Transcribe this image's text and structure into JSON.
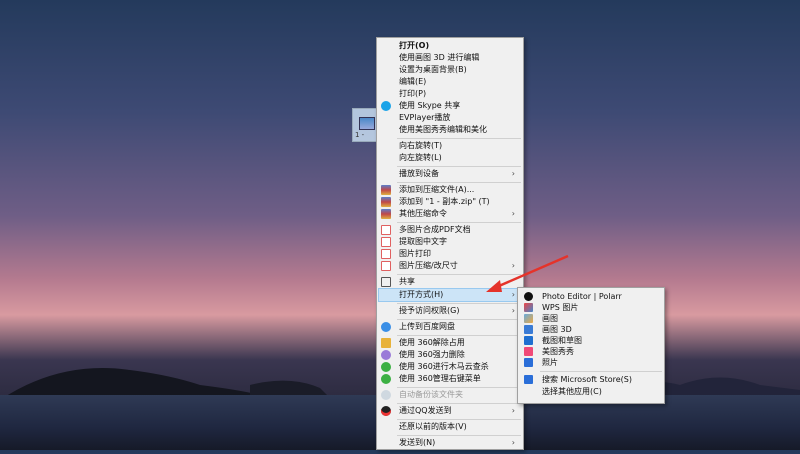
{
  "desktop": {
    "icon_label": "1 -"
  },
  "context_menu": {
    "items": [
      {
        "label": "打开(O)",
        "bold": true
      },
      {
        "label": "使用画图 3D 进行编辑"
      },
      {
        "label": "设置为桌面背景(B)"
      },
      {
        "label": "编辑(E)"
      },
      {
        "label": "打印(P)"
      },
      {
        "label": "使用 Skype 共享",
        "icon": "skype-icon"
      },
      {
        "label": "EVPlayer播放"
      },
      {
        "label": "使用美图秀秀编辑和美化"
      },
      {
        "label": "向右旋转(T)"
      },
      {
        "label": "向左旋转(L)"
      },
      {
        "label": "播放到设备",
        "submenu": true
      },
      {
        "label": "添加到压缩文件(A)...",
        "icon": "archive-icon"
      },
      {
        "label": "添加到 \"1 - 副本.zip\" (T)",
        "icon": "archive-icon"
      },
      {
        "label": "其他压缩命令",
        "icon": "archive-icon",
        "submenu": true
      },
      {
        "label": "多图片合成PDF文档",
        "icon": "pdf-icon"
      },
      {
        "label": "提取图中文字",
        "icon": "text-extract-icon"
      },
      {
        "label": "图片打印",
        "icon": "print-icon"
      },
      {
        "label": "图片压缩/改尺寸",
        "icon": "compress-icon",
        "submenu": true
      },
      {
        "label": "共享",
        "icon": "share-icon"
      },
      {
        "label": "打开方式(H)",
        "submenu": true,
        "highlighted": true
      },
      {
        "label": "授予访问权限(G)",
        "submenu": true
      },
      {
        "label": "上传到百度网盘",
        "icon": "baidu-cloud-icon"
      },
      {
        "label": "使用 360解除占用",
        "icon": "folder-360-icon"
      },
      {
        "label": "使用 360强力删除",
        "icon": "delete-360-icon"
      },
      {
        "label": "使用 360进行木马云查杀",
        "icon": "shield-360-icon"
      },
      {
        "label": "使用 360管理右键菜单",
        "icon": "menu-360-icon"
      },
      {
        "label": "自动备份该文件夹",
        "icon": "backup-icon",
        "disabled": true
      },
      {
        "label": "通过QQ发送到",
        "icon": "qq-icon",
        "submenu": true
      },
      {
        "label": "还原以前的版本(V)"
      },
      {
        "label": "发送到(N)",
        "submenu": true
      }
    ]
  },
  "open_with_menu": {
    "items": [
      {
        "label": "Photo Editor | Polarr",
        "icon": "polarr-icon"
      },
      {
        "label": "WPS 图片",
        "icon": "wps-icon"
      },
      {
        "label": "画图",
        "icon": "paint-icon"
      },
      {
        "label": "画图 3D",
        "icon": "paint3d-icon"
      },
      {
        "label": "截图和草图",
        "icon": "snip-icon"
      },
      {
        "label": "美图秀秀",
        "icon": "meitu-icon"
      },
      {
        "label": "照片",
        "icon": "photos-icon"
      },
      {
        "label": "搜索 Microsoft Store(S)",
        "icon": "store-icon"
      },
      {
        "label": "选择其他应用(C)"
      }
    ]
  },
  "colors": {
    "highlight": "#cce4f7",
    "arrow": "#e5332a"
  }
}
